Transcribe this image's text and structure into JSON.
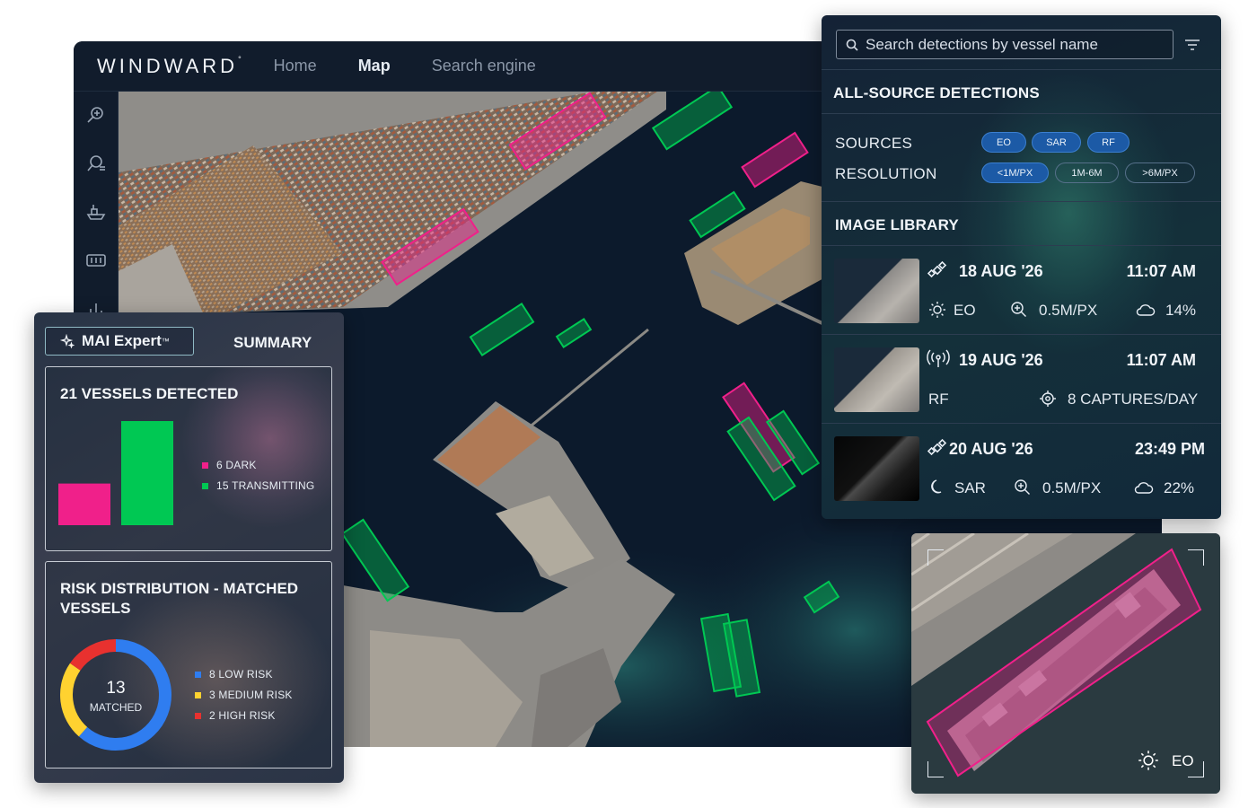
{
  "app": {
    "logo": "WINDWARD",
    "nav": [
      {
        "label": "Home",
        "active": false
      },
      {
        "label": "Map",
        "active": true
      },
      {
        "label": "Search engine",
        "active": false
      }
    ],
    "rail_icons": [
      "search-plus-icon",
      "search-list-icon",
      "ship-icon",
      "dashboard-icon",
      "bar-chart-icon"
    ]
  },
  "detections": {
    "search_placeholder": "Search detections by vessel name",
    "title": "ALL-SOURCE DETECTIONS",
    "sources_label": "SOURCES",
    "sources": [
      {
        "label": "EO",
        "selected": true
      },
      {
        "label": "SAR",
        "selected": true
      },
      {
        "label": "RF",
        "selected": true
      }
    ],
    "resolution_label": "RESOLUTION",
    "resolutions": [
      {
        "label": "<1M/PX",
        "selected": true
      },
      {
        "label": "1M-6M",
        "selected": false
      },
      {
        "label": ">6M/PX",
        "selected": false
      }
    ],
    "library_title": "IMAGE LIBRARY",
    "library": [
      {
        "date": "18 AUG '26",
        "time": "11:07 AM",
        "type_icon": "satellite-icon",
        "source_icon": "sun-icon",
        "source": "EO",
        "resolution": "0.5M/PX",
        "cloud": "14%"
      },
      {
        "date": "19 AUG '26",
        "time": "11:07 AM",
        "type_icon": "radio-signal-icon",
        "source": "RF",
        "captures": "8 CAPTURES/DAY"
      },
      {
        "date": "20 AUG '26",
        "time": "23:49 PM",
        "type_icon": "satellite-icon",
        "source_icon": "moon-icon",
        "source": "SAR",
        "resolution": "0.5M/PX",
        "cloud": "22%"
      }
    ]
  },
  "summary": {
    "mai_label": "MAI Expert",
    "mai_tm": "™",
    "tab": "SUMMARY",
    "vessels": {
      "title": "21 VESSELS DETECTED",
      "legend": [
        {
          "label": "6 DARK",
          "color": "#f0208a"
        },
        {
          "label": "15 TRANSMITTING",
          "color": "#00c853"
        }
      ]
    },
    "risk": {
      "title_line1": "RISK DISTRIBUTION - MATCHED",
      "title_line2": "VESSELS",
      "center_value": "13",
      "center_label": "MATCHED",
      "legend": [
        {
          "label": "8 LOW RISK",
          "color": "#2f7df0"
        },
        {
          "label": "3 MEDIUM RISK",
          "color": "#ffd230"
        },
        {
          "label": "2 HIGH RISK",
          "color": "#e8312f"
        }
      ]
    }
  },
  "chart_data": [
    {
      "type": "bar",
      "categories": [
        "DARK",
        "TRANSMITTING"
      ],
      "values": [
        6,
        15
      ],
      "colors": [
        "#f0208a",
        "#00c853"
      ],
      "title": "21 VESSELS DETECTED"
    },
    {
      "type": "pie",
      "categories": [
        "LOW RISK",
        "MEDIUM RISK",
        "HIGH RISK"
      ],
      "values": [
        8,
        3,
        2
      ],
      "colors": [
        "#2f7df0",
        "#ffd230",
        "#e8312f"
      ],
      "title": "RISK DISTRIBUTION - MATCHED VESSELS"
    }
  ],
  "zoom": {
    "source_icon": "sun-icon",
    "source": "EO"
  }
}
